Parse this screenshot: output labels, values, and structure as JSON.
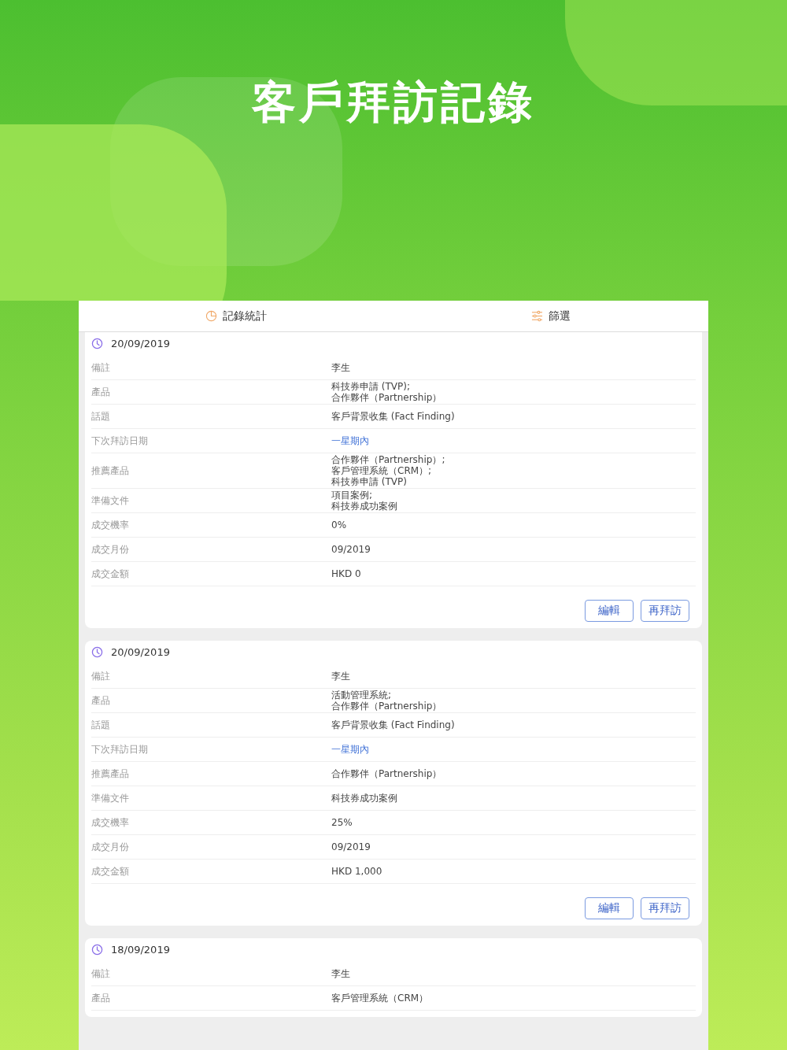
{
  "headline": "客戶拜訪記錄",
  "tabs": [
    {
      "label": "記錄統計"
    },
    {
      "label": "篩選"
    }
  ],
  "records": [
    {
      "date": "20/09/2019",
      "fields": [
        {
          "label": "備註",
          "value": "李生",
          "kind": "text"
        },
        {
          "label": "產品",
          "value": "科技券申請 (TVP);\n合作夥伴（Partnership）",
          "kind": "text"
        },
        {
          "label": "話題",
          "value": "客戶背景收集 (Fact Finding)",
          "kind": "text"
        },
        {
          "label": "下次拜訪日期",
          "value": "一星期內",
          "kind": "link"
        },
        {
          "label": "推薦產品",
          "value": "合作夥伴（Partnership）;\n客戶管理系統（CRM）;\n科技券申請 (TVP)",
          "kind": "text"
        },
        {
          "label": "準備文件",
          "value": "項目案例;\n科技券成功案例",
          "kind": "text"
        },
        {
          "label": "成交機率",
          "value": "0%",
          "kind": "text"
        },
        {
          "label": "成交月份",
          "value": "09/2019",
          "kind": "text"
        },
        {
          "label": "成交金額",
          "value": "HKD 0",
          "kind": "text"
        }
      ],
      "buttons": [
        "編輯",
        "再拜訪"
      ]
    },
    {
      "date": "20/09/2019",
      "fields": [
        {
          "label": "備註",
          "value": "李生",
          "kind": "text"
        },
        {
          "label": "產品",
          "value": "活動管理系統;\n合作夥伴（Partnership）",
          "kind": "text"
        },
        {
          "label": "話題",
          "value": "客戶背景收集 (Fact Finding)",
          "kind": "text"
        },
        {
          "label": "下次拜訪日期",
          "value": "一星期內",
          "kind": "link"
        },
        {
          "label": "推薦產品",
          "value": "合作夥伴（Partnership）",
          "kind": "text"
        },
        {
          "label": "準備文件",
          "value": "科技券成功案例",
          "kind": "text"
        },
        {
          "label": "成交機率",
          "value": "25%",
          "kind": "text"
        },
        {
          "label": "成交月份",
          "value": "09/2019",
          "kind": "text"
        },
        {
          "label": "成交金額",
          "value": "HKD 1,000",
          "kind": "text"
        }
      ],
      "buttons": [
        "編輯",
        "再拜訪"
      ]
    },
    {
      "date": "18/09/2019",
      "fields": [
        {
          "label": "備註",
          "value": "李生",
          "kind": "text"
        },
        {
          "label": "產品",
          "value": "客戶管理系統（CRM）",
          "kind": "text"
        }
      ]
    }
  ]
}
